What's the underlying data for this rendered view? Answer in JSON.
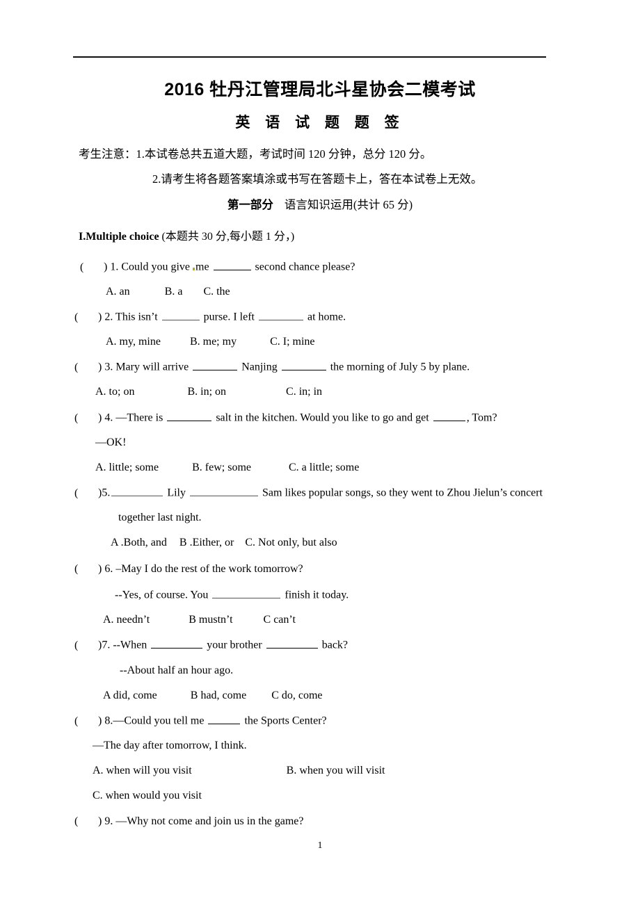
{
  "document": {
    "title": "2016 牡丹江管理局北斗星协会二模考试",
    "subtitle": "英 语 试 题 题 签",
    "notice_line_1": "考生注意：1.本试卷总共五道大题，考试时间 120 分钟，总分 120 分。",
    "notice_line_2": "2.请考生将各题答案填涂或书写在答题卡上，答在本试卷上无效。",
    "part_heading_label": "第一部分",
    "part_heading_text": "语言知识运用(共计 65 分)",
    "page_number": "1"
  },
  "section": {
    "number_label": "I.Multiple choice ",
    "scoring_note": "(本题共 30 分,每小题 1 分，)"
  },
  "questions": [
    {
      "paren": "(",
      "close_paren": ")",
      "number": "1.",
      "stem_a": "Could you give ",
      "stem_b": "me ",
      "stem_c": " second chance please?",
      "options": [
        {
          "label": "A. an"
        },
        {
          "label": "B. a"
        },
        {
          "label": "C. the"
        }
      ]
    },
    {
      "paren": "(",
      "close_paren": ")",
      "number": "2.",
      "stem_a": "This isn’t ",
      "stem_b": " purse. I left ",
      "stem_c": " at home.",
      "options": [
        {
          "label": "A. my, mine"
        },
        {
          "label": "B. me; my"
        },
        {
          "label": "C. I; mine"
        }
      ]
    },
    {
      "paren": "(",
      "close_paren": ")",
      "number": "3.",
      "stem_a": "Mary will arrive ",
      "stem_b": " Nanjing ",
      "stem_c": " the morning of July 5 by plane.",
      "options": [
        {
          "label": "A. to; on"
        },
        {
          "label": "B. in; on"
        },
        {
          "label": "C. in; in"
        }
      ]
    },
    {
      "paren": "(",
      "close_paren": ")",
      "number": "4.",
      "stem_a": "—There is ",
      "stem_b": " salt in the kitchen. Would you like to go and get ",
      "stem_c": ", Tom?",
      "reply": "—OK!",
      "options": [
        {
          "label": "A. little; some"
        },
        {
          "label": "B. few; some"
        },
        {
          "label": "C. a little; some"
        }
      ]
    },
    {
      "paren": "(",
      "close_paren": ")",
      "number": "5.",
      "stem_a": "",
      "stem_b": " Lily ",
      "stem_c": " Sam likes popular songs, so they went to Zhou Jielun’s concert",
      "continuation": "together last night.",
      "options": [
        {
          "label": "A .Both, and"
        },
        {
          "label": "B .Either, or"
        },
        {
          "label": "C. Not only, but also"
        }
      ]
    },
    {
      "paren": "(",
      "close_paren": ")",
      "number": "6.",
      "stem_a": "–May I do the rest of the work tomorrow?",
      "reply_a": "--Yes, of course. You ",
      "reply_b": " finish it today.",
      "options": [
        {
          "label": "A. needn’t"
        },
        {
          "label": "B mustn’t"
        },
        {
          "label": "C can’t"
        }
      ]
    },
    {
      "paren": "(",
      "close_paren": ")",
      "number": "7.",
      "stem_a": "--When ",
      "stem_b": " your brother ",
      "stem_c": " back?",
      "reply": "--About half an hour ago.",
      "options": [
        {
          "label": "A did, come"
        },
        {
          "label": "B had, come"
        },
        {
          "label": "C do, come"
        }
      ]
    },
    {
      "paren": "(",
      "close_paren": ")",
      "number": "8.",
      "stem_a": "—Could you tell me ",
      "stem_b": " the Sports Center?",
      "reply": "—The day after tomorrow, I think.",
      "options": [
        {
          "label": "A. when will you visit"
        },
        {
          "label": "B. when you will visit"
        },
        {
          "label": "C. when would you visit"
        }
      ]
    },
    {
      "paren": "(",
      "close_paren": ")",
      "number": "9.",
      "stem_a": "—Why not come and join us in the game?"
    }
  ]
}
